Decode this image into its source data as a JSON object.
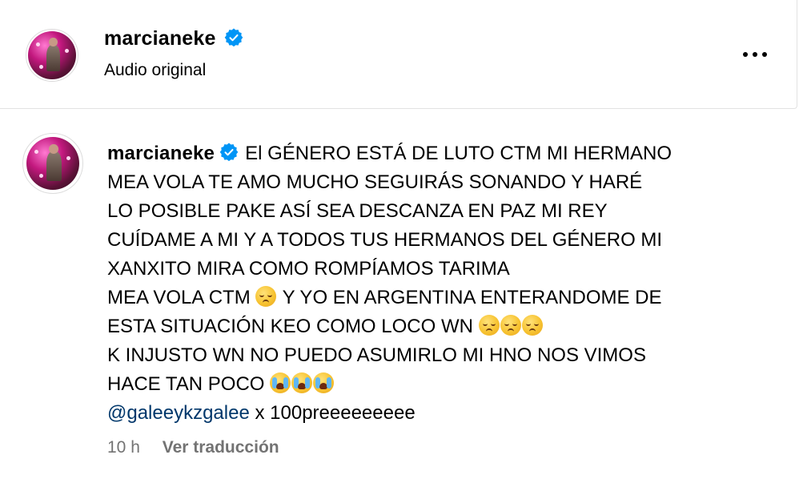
{
  "header": {
    "username": "marcianeke",
    "subtitle": "Audio original",
    "more_icon": "more-horizontal-icon"
  },
  "comment": {
    "username": "marcianeke",
    "text_lines": [
      "El GÉNERO ESTÁ DE LUTO CTM MI HERMANO",
      "MEA VOLA TE AMO MUCHO SEGUIRÁS SONANDO Y HARÉ",
      "LO POSIBLE PAKE ASÍ SEA DESCANZA EN PAZ MI REY",
      "CUÍDAME A MI Y A TODOS TUS HERMANOS DEL GÉNERO MI",
      "XANXITO MIRA COMO ROMPÍAMOS TARIMA",
      "MEA VOLA CTM",
      "Y YO EN ARGENTINA ENTERANDOME DE",
      "ESTA SITUACIÓN KEO COMO LOCO WN",
      "K INJUSTO WN NO PUEDO ASUMIRLO MI HNO NOS VIMOS",
      "HACE TAN POCO"
    ],
    "mention": "@galeeykzgalee",
    "mention_suffix": "x 100preeeeeeeee",
    "emojis": {
      "sad": "disappointed-face",
      "cry": "loudly-crying-face"
    }
  },
  "meta": {
    "time": "10 h",
    "translate_label": "Ver traducción"
  },
  "colors": {
    "verified": "#0095f6",
    "mention": "#00376b",
    "meta": "#737373",
    "border": "#e2e2e2"
  }
}
